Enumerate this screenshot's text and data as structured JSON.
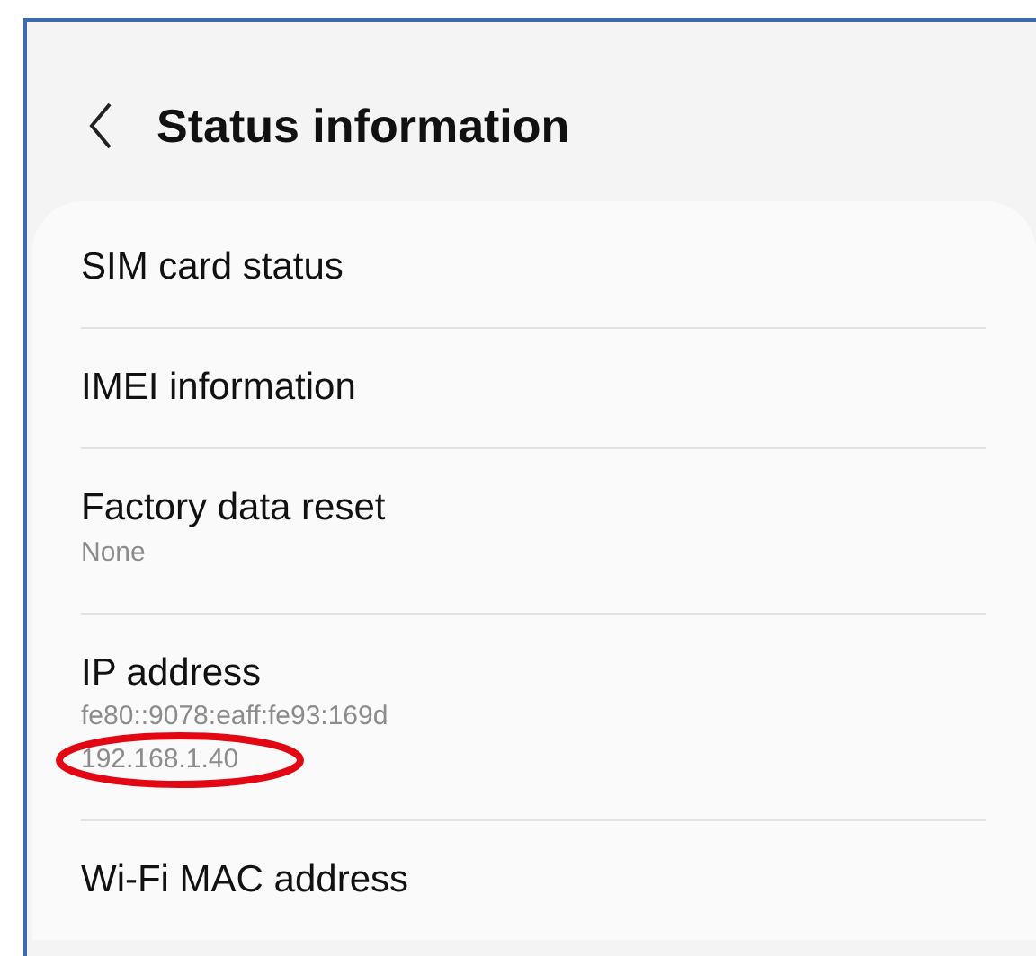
{
  "header": {
    "title": "Status information"
  },
  "items": [
    {
      "title": "SIM card status"
    },
    {
      "title": "IMEI information"
    },
    {
      "title": "Factory data reset",
      "details": [
        {
          "text": "None",
          "circled": false
        }
      ]
    },
    {
      "title": "IP address",
      "details": [
        {
          "text": "fe80::9078:eaff:fe93:169d",
          "circled": false
        },
        {
          "text": "192.168.1.40",
          "circled": true
        }
      ]
    },
    {
      "title": "Wi-Fi MAC address"
    }
  ]
}
